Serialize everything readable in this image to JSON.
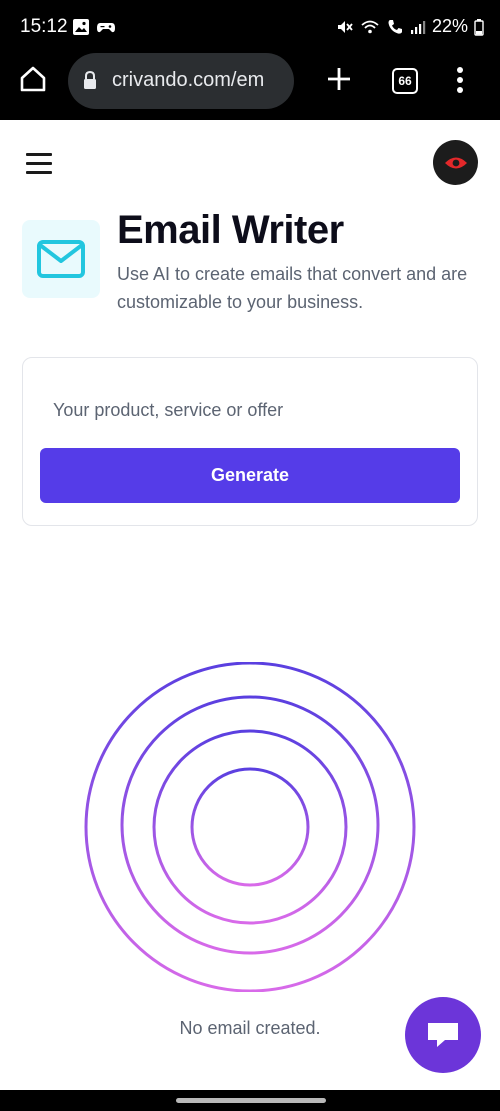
{
  "status_bar": {
    "time": "15:12",
    "battery": "22%",
    "left_icons": [
      "image-icon",
      "game-controller-icon"
    ],
    "right_icons": [
      "mute-icon",
      "wifi-icon",
      "call-icon",
      "signal-icon",
      "battery-icon"
    ]
  },
  "browser": {
    "url": "crivando.com/em",
    "tab_count": "66",
    "icons": [
      "home-icon",
      "lock-icon",
      "plus-icon",
      "tabs-icon",
      "overflow-menu-icon"
    ]
  },
  "page": {
    "title": "Email Writer",
    "subtitle": "Use AI to create emails that convert and are customizable to your business.",
    "input_placeholder": "Your product, service or offer",
    "generate_label": "Generate",
    "empty_state": "No email created.",
    "icons": [
      "hamburger-menu-icon",
      "eye-icon",
      "mail-icon",
      "chat-icon"
    ]
  },
  "colors": {
    "accent": "#553ce8",
    "chat_fab": "#6c35d9",
    "mail_icon": "#22c6df",
    "eye": "#e3282a"
  }
}
